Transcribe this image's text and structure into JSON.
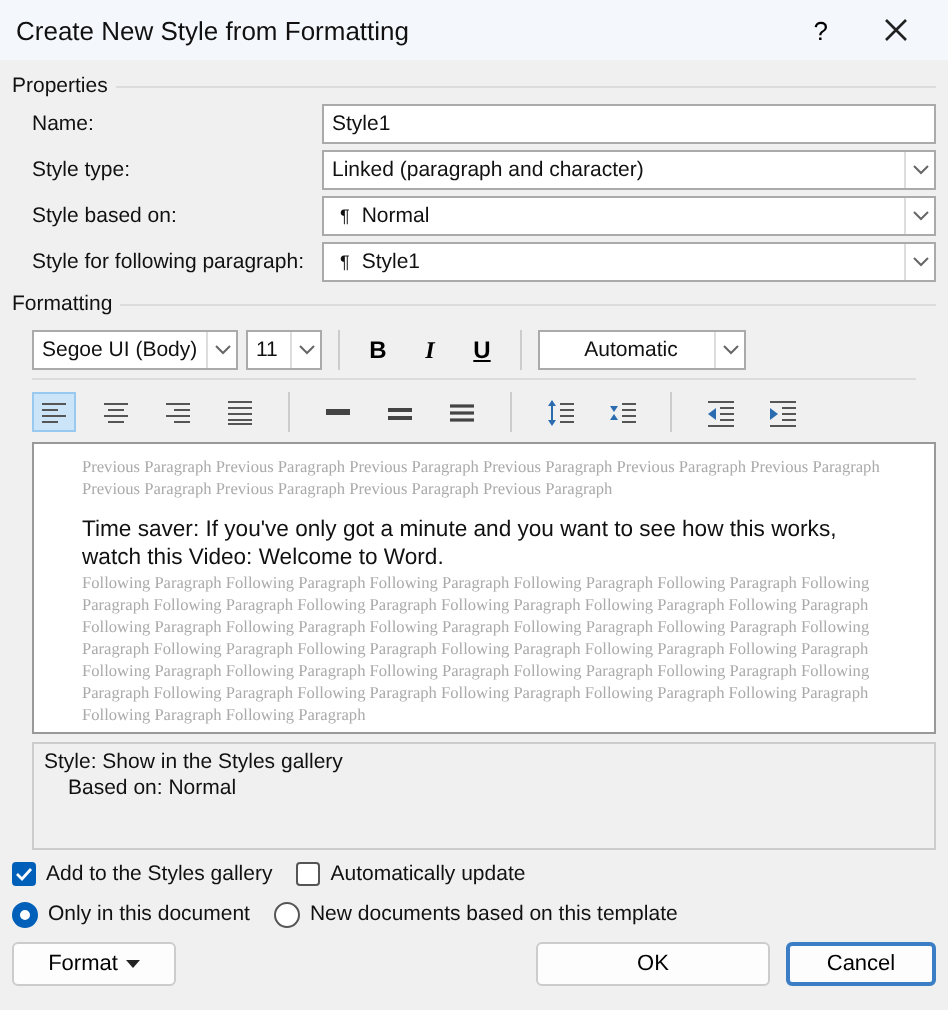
{
  "window": {
    "title": "Create New Style from Formatting",
    "help": "?"
  },
  "properties": {
    "heading": "Properties",
    "fields": [
      {
        "label": "Name:",
        "value": "Style1",
        "kind": "text"
      },
      {
        "label": "Style type:",
        "value": "Linked (paragraph and character)",
        "kind": "dropdown"
      },
      {
        "label": "Style based on:",
        "value": "Normal",
        "kind": "dropdown",
        "prefix": "¶"
      },
      {
        "label": "Style for following paragraph:",
        "value": "Style1",
        "kind": "dropdown",
        "prefix": "¶"
      }
    ]
  },
  "formatting": {
    "heading": "Formatting",
    "font": "Segoe UI (Body)",
    "size": "11",
    "bold": "B",
    "italic": "I",
    "underline": "U",
    "font_color": "Automatic",
    "paragraph_tools": [
      {
        "kind": "align-left",
        "selected": true
      },
      {
        "kind": "align-center",
        "selected": false
      },
      {
        "kind": "align-right",
        "selected": false
      },
      {
        "kind": "justify",
        "selected": false
      },
      {
        "kind": "single-spacing",
        "selected": false
      },
      {
        "kind": "one-half-spacing",
        "selected": false
      },
      {
        "kind": "double-spacing",
        "selected": false
      },
      {
        "kind": "space-more",
        "selected": false
      },
      {
        "kind": "space-less",
        "selected": false
      },
      {
        "kind": "indent-decrease",
        "selected": false
      },
      {
        "kind": "indent-increase",
        "selected": false
      }
    ]
  },
  "preview": {
    "previous": "Previous Paragraph Previous Paragraph Previous Paragraph Previous Paragraph Previous Paragraph Previous Paragraph Previous Paragraph Previous Paragraph Previous Paragraph Previous Paragraph",
    "sample": "Time saver: If you've only got a minute and you want to see how this works, watch this Video: Welcome to Word.",
    "following": "Following Paragraph Following Paragraph Following Paragraph Following Paragraph Following Paragraph Following Paragraph Following Paragraph Following Paragraph Following Paragraph Following Paragraph Following Paragraph Following Paragraph Following Paragraph Following Paragraph Following Paragraph Following Paragraph Following Paragraph Following Paragraph Following Paragraph Following Paragraph Following Paragraph Following Paragraph Following Paragraph Following Paragraph Following Paragraph Following Paragraph Following Paragraph Following Paragraph Following Paragraph Following Paragraph Following Paragraph Following Paragraph Following Paragraph Following Paragraph Following Paragraph"
  },
  "description": [
    "Style: Show in the Styles gallery",
    "Based on: Normal"
  ],
  "checkboxes": [
    {
      "label": "Add to the Styles gallery",
      "checked": true
    },
    {
      "label": "Automatically update",
      "checked": false
    }
  ],
  "radios": [
    {
      "label": "Only in this document",
      "selected": true
    },
    {
      "label": "New documents based on this template",
      "selected": false
    }
  ],
  "buttons": {
    "format": "Format",
    "ok": "OK",
    "cancel": "Cancel"
  }
}
